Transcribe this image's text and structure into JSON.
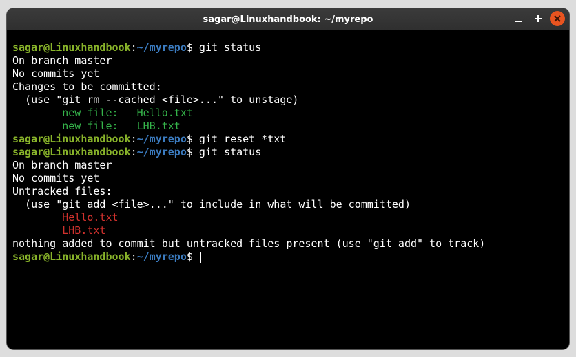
{
  "window": {
    "title": "sagar@Linuxhandbook: ~/myrepo"
  },
  "prompt": {
    "user": "sagar@Linuxhandbook",
    "sep": ":",
    "path": "~/myrepo",
    "symbol": "$"
  },
  "commands": {
    "c1": " git status",
    "c2": " git reset *txt",
    "c3": " git status",
    "c4": " "
  },
  "output": {
    "branch": "On branch master",
    "blank": "",
    "nocommits": "No commits yet",
    "changes_hdr": "Changes to be committed:",
    "unstage_hint": "  (use \"git rm --cached <file>...\" to unstage)",
    "newfile1": "        new file:   Hello.txt",
    "newfile2": "        new file:   LHB.txt",
    "untracked_hdr": "Untracked files:",
    "include_hint": "  (use \"git add <file>...\" to include in what will be committed)",
    "uf1": "        Hello.txt",
    "uf2": "        LHB.txt",
    "nothing": "nothing added to commit but untracked files present (use \"git add\" to track)"
  }
}
